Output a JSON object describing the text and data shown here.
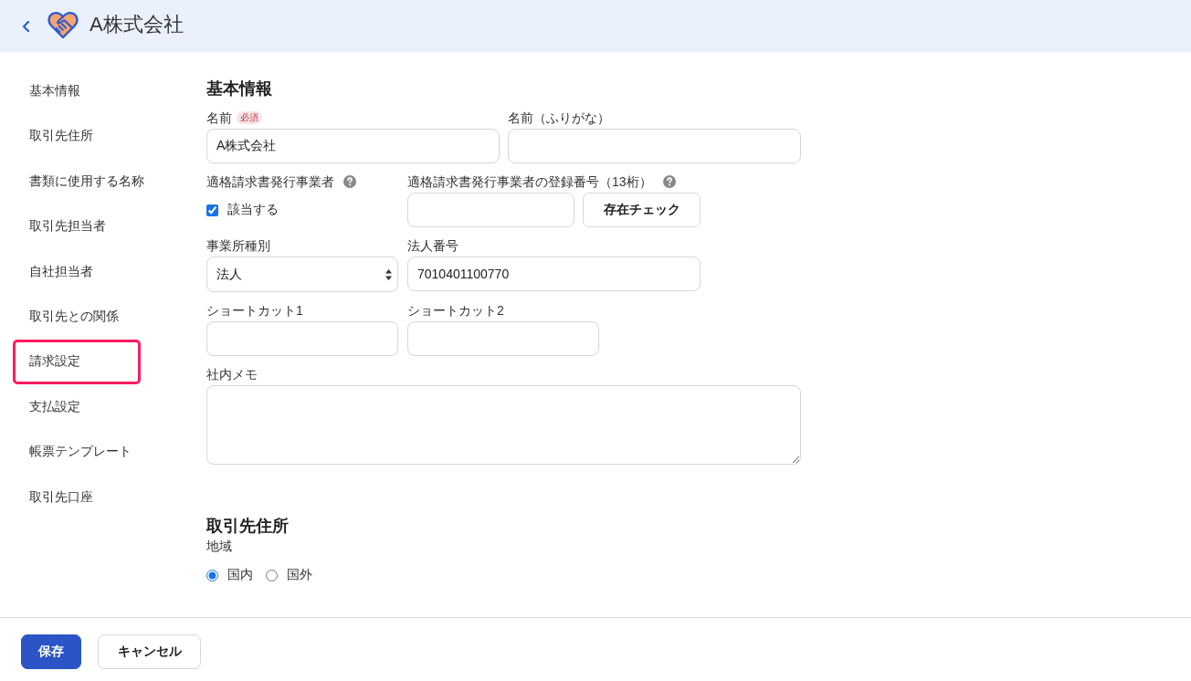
{
  "header": {
    "title": "A株式会社"
  },
  "sidebar": {
    "items": [
      {
        "label": "基本情報",
        "highlighted": false
      },
      {
        "label": "取引先住所",
        "highlighted": false
      },
      {
        "label": "書類に使用する名称",
        "highlighted": false
      },
      {
        "label": "取引先担当者",
        "highlighted": false
      },
      {
        "label": "自社担当者",
        "highlighted": false
      },
      {
        "label": "取引先との関係",
        "highlighted": false
      },
      {
        "label": "請求設定",
        "highlighted": true
      },
      {
        "label": "支払設定",
        "highlighted": false
      },
      {
        "label": "帳票テンプレート",
        "highlighted": false
      },
      {
        "label": "取引先口座",
        "highlighted": false
      }
    ]
  },
  "basic_info": {
    "title": "基本情報",
    "name": {
      "label": "名前",
      "badge": "必須",
      "value": "A株式会社"
    },
    "name_kana": {
      "label": "名前（ふりがな）"
    },
    "qualified_issuer": {
      "label": "適格請求書発行事業者",
      "option": "該当する",
      "checked": true
    },
    "registration_number": {
      "label": "適格請求書発行事業者の登録番号（13桁）",
      "button": "存在チェック"
    },
    "office_type": {
      "label": "事業所種別",
      "value": "法人"
    },
    "corporate_number": {
      "label": "法人番号",
      "value": "7010401100770"
    },
    "shortcut_1": {
      "label": "ショートカット1"
    },
    "shortcut_2": {
      "label": "ショートカット2"
    },
    "memo": {
      "label": "社内メモ"
    }
  },
  "address": {
    "title": "取引先住所",
    "region": {
      "label": "地域",
      "options": [
        {
          "label": "国内",
          "selected": true
        },
        {
          "label": "国外",
          "selected": false
        }
      ]
    }
  },
  "footer": {
    "buttons": [
      {
        "label": "保存",
        "kind": "primary"
      },
      {
        "label": "キャンセル",
        "kind": "secondary"
      }
    ]
  }
}
